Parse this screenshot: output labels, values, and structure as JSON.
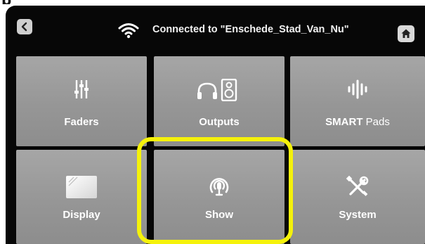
{
  "top_fragment": "p",
  "header": {
    "status_text": "Connected to \"Enschede_Stad_Van_Nu\""
  },
  "tiles": [
    {
      "label": "Faders",
      "icon": "faders-icon"
    },
    {
      "label": "Outputs",
      "icon": "outputs-icon"
    },
    {
      "label_bold": "SMART",
      "label_rest": " Pads",
      "icon": "smart-pads-icon"
    },
    {
      "label": "Display",
      "icon": "display-icon"
    },
    {
      "label": "Show",
      "icon": "show-microphone-icon"
    },
    {
      "label": "System",
      "icon": "system-tools-icon"
    }
  ],
  "colors": {
    "background": "#070707",
    "tile": "#9b9b9b",
    "highlight": "#f5f20a",
    "text": "#ffffff"
  }
}
